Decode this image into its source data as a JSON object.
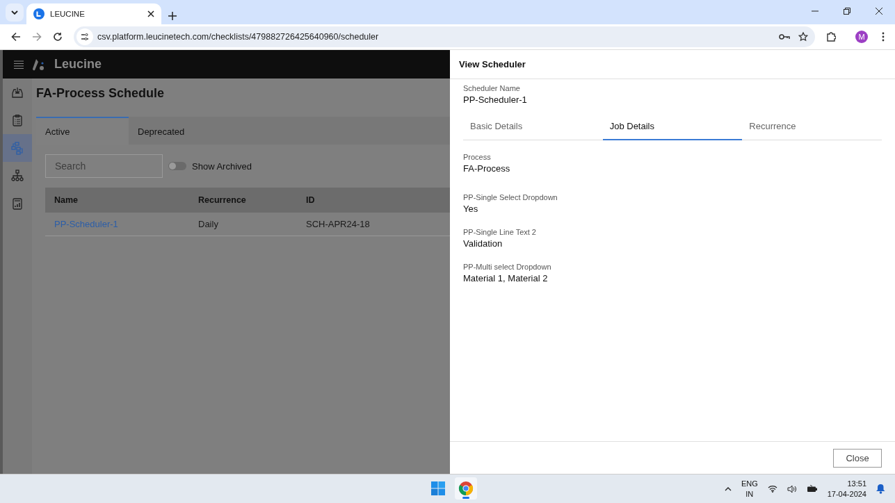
{
  "browser": {
    "tab_title": "LEUCINE",
    "url": "csv.platform.leucinetech.com/checklists/479882726425640960/scheduler",
    "profile_initial": "M"
  },
  "app": {
    "brand": "Leucine",
    "nav": [
      {
        "kind": "inbox",
        "selected": false
      },
      {
        "kind": "checklist",
        "selected": false
      },
      {
        "kind": "flow",
        "selected": true
      },
      {
        "kind": "hierarchy",
        "selected": false
      },
      {
        "kind": "report",
        "selected": false
      }
    ],
    "page_title": "FA-Process Schedule",
    "tabs": [
      {
        "label": "Active",
        "selected": true
      },
      {
        "label": "Deprecated",
        "selected": false
      }
    ],
    "search": {
      "placeholder": "Search"
    },
    "show_archived": {
      "label": "Show Archived",
      "on": false
    },
    "table": {
      "columns": [
        "Name",
        "Recurrence",
        "ID"
      ],
      "rows": [
        [
          "PP-Scheduler-1",
          "Daily",
          "SCH-APR24-18"
        ]
      ]
    }
  },
  "drawer": {
    "title": "View Scheduler",
    "name_label": "Scheduler Name",
    "name_value": "PP-Scheduler-1",
    "tabs": [
      {
        "label": "Basic Details",
        "selected": false
      },
      {
        "label": "Job Details",
        "selected": true
      },
      {
        "label": "Recurrence",
        "selected": false
      }
    ],
    "fields": [
      {
        "label": "Process",
        "value": "FA-Process"
      },
      {
        "label": "PP-Single Select Dropdown",
        "value": "Yes"
      },
      {
        "label": "PP-Single Line Text 2",
        "value": "Validation"
      },
      {
        "label": "PP-Multi select Dropdown",
        "value": "Material 1, Material 2"
      }
    ],
    "close_button": "Close"
  },
  "taskbar": {
    "language": "ENG",
    "region": "IN",
    "time": "13:51",
    "date": "17-04-2024"
  }
}
